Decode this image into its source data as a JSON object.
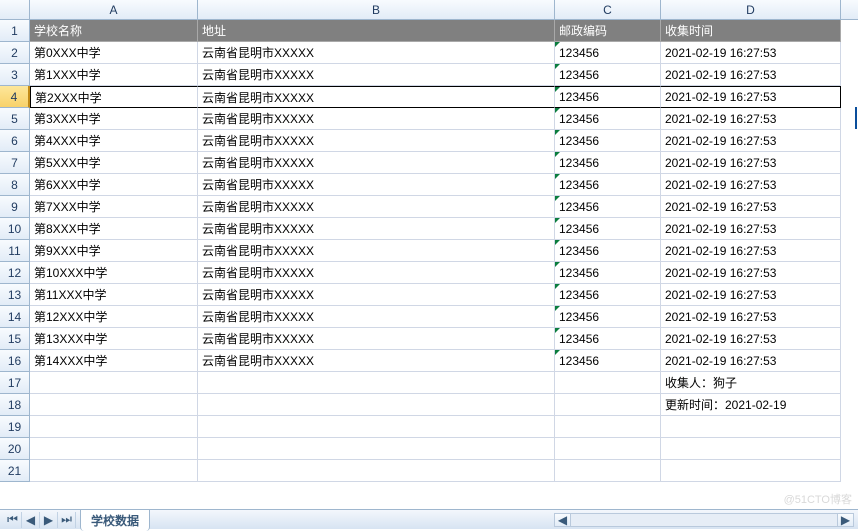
{
  "columns": {
    "A": "A",
    "B": "B",
    "C": "C",
    "D": "D"
  },
  "rownums": [
    "1",
    "2",
    "3",
    "4",
    "5",
    "6",
    "7",
    "8",
    "9",
    "10",
    "11",
    "12",
    "13",
    "14",
    "15",
    "16",
    "17",
    "18",
    "19",
    "20",
    "21"
  ],
  "header": {
    "A": "学校名称",
    "B": "地址",
    "C": "邮政编码",
    "D": "收集时间"
  },
  "rows": [
    {
      "A": "第0XXX中学",
      "B": "云南省昆明市XXXXX",
      "C": "123456",
      "D": "2021-02-19 16:27:53"
    },
    {
      "A": "第1XXX中学",
      "B": "云南省昆明市XXXXX",
      "C": "123456",
      "D": "2021-02-19 16:27:53"
    },
    {
      "A": "第2XXX中学",
      "B": "云南省昆明市XXXXX",
      "C": "123456",
      "D": "2021-02-19 16:27:53"
    },
    {
      "A": "第3XXX中学",
      "B": "云南省昆明市XXXXX",
      "C": "123456",
      "D": "2021-02-19 16:27:53"
    },
    {
      "A": "第4XXX中学",
      "B": "云南省昆明市XXXXX",
      "C": "123456",
      "D": "2021-02-19 16:27:53"
    },
    {
      "A": "第5XXX中学",
      "B": "云南省昆明市XXXXX",
      "C": "123456",
      "D": "2021-02-19 16:27:53"
    },
    {
      "A": "第6XXX中学",
      "B": "云南省昆明市XXXXX",
      "C": "123456",
      "D": "2021-02-19 16:27:53"
    },
    {
      "A": "第7XXX中学",
      "B": "云南省昆明市XXXXX",
      "C": "123456",
      "D": "2021-02-19 16:27:53"
    },
    {
      "A": "第8XXX中学",
      "B": "云南省昆明市XXXXX",
      "C": "123456",
      "D": "2021-02-19 16:27:53"
    },
    {
      "A": "第9XXX中学",
      "B": "云南省昆明市XXXXX",
      "C": "123456",
      "D": "2021-02-19 16:27:53"
    },
    {
      "A": "第10XXX中学",
      "B": "云南省昆明市XXXXX",
      "C": "123456",
      "D": "2021-02-19 16:27:53"
    },
    {
      "A": "第11XXX中学",
      "B": "云南省昆明市XXXXX",
      "C": "123456",
      "D": "2021-02-19 16:27:53"
    },
    {
      "A": "第12XXX中学",
      "B": "云南省昆明市XXXXX",
      "C": "123456",
      "D": "2021-02-19 16:27:53"
    },
    {
      "A": "第13XXX中学",
      "B": "云南省昆明市XXXXX",
      "C": "123456",
      "D": "2021-02-19 16:27:53"
    },
    {
      "A": "第14XXX中学",
      "B": "云南省昆明市XXXXX",
      "C": "123456",
      "D": "2021-02-19 16:27:53"
    }
  ],
  "extra": {
    "r17D": "收集人：狗子",
    "r18D": "更新时间：2021-02-19"
  },
  "tab": "学校数据",
  "nav": {
    "first": "⏮",
    "prev": "◀",
    "next": "▶",
    "last": "⏭"
  },
  "scroll": {
    "left": "◀",
    "right": "▶"
  },
  "watermark": "@51CTO博客",
  "selected_row": 4
}
